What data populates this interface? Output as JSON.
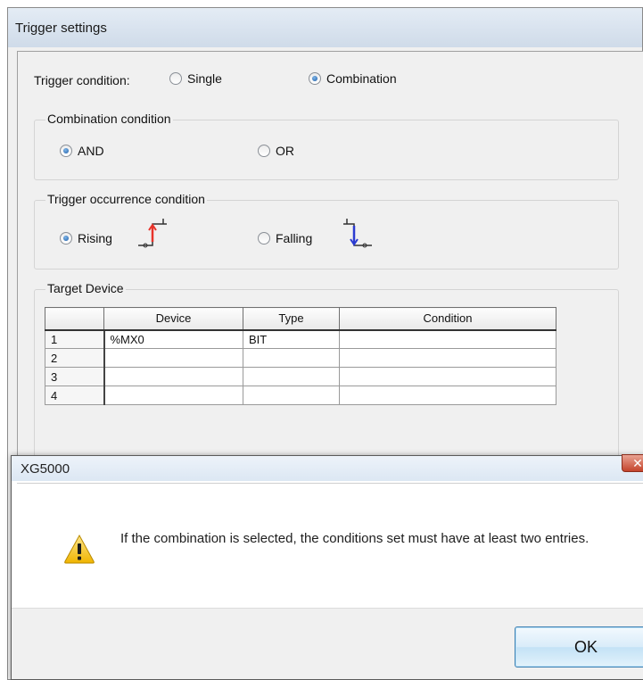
{
  "trigger_window": {
    "title": "Trigger settings",
    "trigger_condition": {
      "label": "Trigger condition:",
      "options": [
        {
          "label": "Single",
          "checked": false
        },
        {
          "label": "Combination",
          "checked": true
        }
      ]
    },
    "combination_condition": {
      "group_label": "Combination condition",
      "options": [
        {
          "label": "AND",
          "checked": true
        },
        {
          "label": "OR",
          "checked": false
        }
      ]
    },
    "occurrence_condition": {
      "group_label": "Trigger occurrence condition",
      "options": [
        {
          "label": "Rising",
          "checked": true,
          "icon": "rising-edge-icon"
        },
        {
          "label": "Falling",
          "checked": false,
          "icon": "falling-edge-icon"
        }
      ]
    },
    "target_device": {
      "group_label": "Target Device",
      "columns": [
        "Device",
        "Type",
        "Condition"
      ],
      "rows": [
        {
          "index": "1",
          "device": "%MX0",
          "type": "BIT",
          "condition": ""
        },
        {
          "index": "2",
          "device": "",
          "type": "",
          "condition": ""
        },
        {
          "index": "3",
          "device": "",
          "type": "",
          "condition": ""
        },
        {
          "index": "4",
          "device": "",
          "type": "",
          "condition": ""
        }
      ]
    }
  },
  "message_box": {
    "title": "XG5000",
    "icon": "warning-icon",
    "message": "If the combination is selected, the conditions set must have at least two entries.",
    "ok_label": "OK"
  },
  "colors": {
    "rising_edge": "#e8332a",
    "falling_edge": "#2b3bd1",
    "ok_border": "#3c7fb1",
    "warning_fill": "#f5c518"
  }
}
